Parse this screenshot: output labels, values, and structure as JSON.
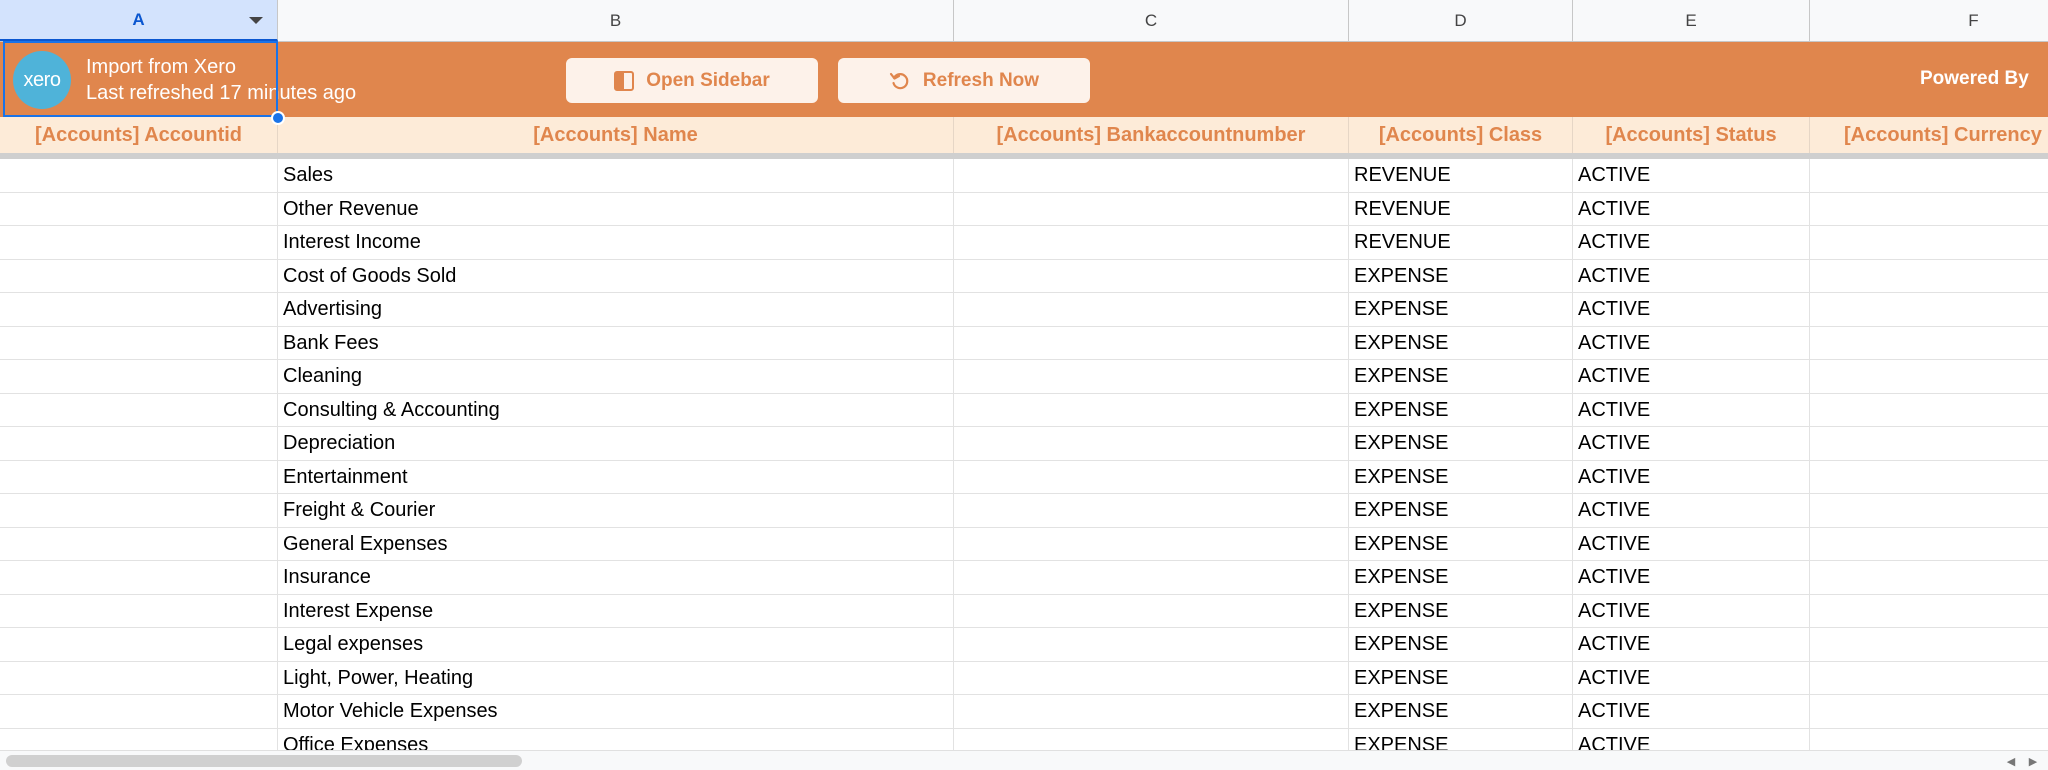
{
  "columns": [
    "A",
    "B",
    "C",
    "D",
    "E",
    "F"
  ],
  "selected_column": "A",
  "banner": {
    "logo_text": "xero",
    "title": "Import from Xero",
    "subtitle": "Last refreshed 17 minutes ago",
    "open_sidebar_label": "Open Sidebar",
    "refresh_label": "Refresh Now",
    "powered_by": "Powered By",
    "accent_color": "#e0864d",
    "logo_color": "#4fb3d9"
  },
  "field_headers": [
    "[Accounts] Accountid",
    "[Accounts] Name",
    "[Accounts] Bankaccountnumber",
    "[Accounts] Class",
    "[Accounts] Status",
    "[Accounts] Currency"
  ],
  "rows": [
    {
      "name": "Sales",
      "class": "REVENUE",
      "status": "ACTIVE"
    },
    {
      "name": "Other Revenue",
      "class": "REVENUE",
      "status": "ACTIVE"
    },
    {
      "name": "Interest Income",
      "class": "REVENUE",
      "status": "ACTIVE"
    },
    {
      "name": "Cost of Goods Sold",
      "class": "EXPENSE",
      "status": "ACTIVE"
    },
    {
      "name": "Advertising",
      "class": "EXPENSE",
      "status": "ACTIVE"
    },
    {
      "name": "Bank Fees",
      "class": "EXPENSE",
      "status": "ACTIVE"
    },
    {
      "name": "Cleaning",
      "class": "EXPENSE",
      "status": "ACTIVE"
    },
    {
      "name": "Consulting & Accounting",
      "class": "EXPENSE",
      "status": "ACTIVE"
    },
    {
      "name": "Depreciation",
      "class": "EXPENSE",
      "status": "ACTIVE"
    },
    {
      "name": "Entertainment",
      "class": "EXPENSE",
      "status": "ACTIVE"
    },
    {
      "name": "Freight & Courier",
      "class": "EXPENSE",
      "status": "ACTIVE"
    },
    {
      "name": "General Expenses",
      "class": "EXPENSE",
      "status": "ACTIVE"
    },
    {
      "name": "Insurance",
      "class": "EXPENSE",
      "status": "ACTIVE"
    },
    {
      "name": "Interest Expense",
      "class": "EXPENSE",
      "status": "ACTIVE"
    },
    {
      "name": "Legal expenses",
      "class": "EXPENSE",
      "status": "ACTIVE"
    },
    {
      "name": "Light, Power, Heating",
      "class": "EXPENSE",
      "status": "ACTIVE"
    },
    {
      "name": "Motor Vehicle Expenses",
      "class": "EXPENSE",
      "status": "ACTIVE"
    },
    {
      "name": "Office Expenses",
      "class": "EXPENSE",
      "status": "ACTIVE"
    }
  ]
}
